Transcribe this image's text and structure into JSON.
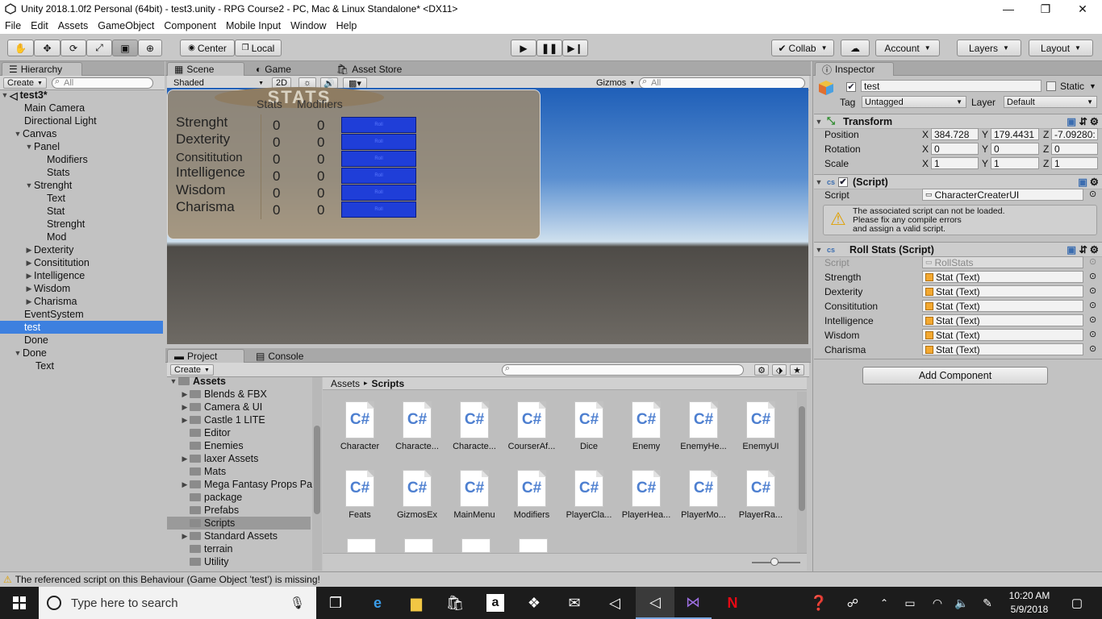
{
  "window": {
    "title": "Unity 2018.1.0f2 Personal (64bit) - test3.unity - RPG Course2 - PC, Mac & Linux Standalone* <DX11>",
    "minimize": "—",
    "maximize": "❐",
    "close": "✕"
  },
  "menu": [
    "File",
    "Edit",
    "Assets",
    "GameObject",
    "Component",
    "Mobile Input",
    "Window",
    "Help"
  ],
  "toolbar": {
    "pivot": "Center",
    "space": "Local",
    "collab": "Collab",
    "account": "Account",
    "layers": "Layers",
    "layout": "Layout"
  },
  "hierarchy": {
    "tab": "Hierarchy",
    "create": "Create",
    "search_placeholder": "All",
    "scene": "test3*",
    "items": [
      "Main Camera",
      "Directional Light",
      "Canvas",
      "Panel",
      "Modifiers",
      "Stats",
      "Strenght",
      "Text",
      "Stat",
      "Strenght",
      "Mod",
      "Dexterity",
      "Consititution",
      "Intelligence",
      "Wisdom",
      "Charisma",
      "EventSystem",
      "test",
      "Done",
      "Done",
      "Text"
    ]
  },
  "scene": {
    "tabs": [
      "Scene",
      "Game",
      "Asset Store"
    ],
    "shading": "Shaded",
    "mode2d": "2D",
    "gizmos": "Gizmos",
    "search_placeholder": "All",
    "panel": {
      "banner": "STATS",
      "col_stats": "Stats",
      "col_mods": "Modifiers",
      "rows": [
        {
          "name": "Strenght",
          "stat": "0",
          "mod": "0",
          "btn": "Roll"
        },
        {
          "name": "Dexterity",
          "stat": "0",
          "mod": "0",
          "btn": "Roll"
        },
        {
          "name": "Consititution",
          "stat": "0",
          "mod": "0",
          "btn": "Roll"
        },
        {
          "name": "Intelligence",
          "stat": "0",
          "mod": "0",
          "btn": "Roll"
        },
        {
          "name": "Wisdom",
          "stat": "0",
          "mod": "0",
          "btn": "Roll"
        },
        {
          "name": "Charisma",
          "stat": "0",
          "mod": "0",
          "btn": "Roll"
        }
      ]
    }
  },
  "project": {
    "tabs": [
      "Project",
      "Console"
    ],
    "create": "Create",
    "root": "Assets",
    "folders": [
      "Blends & FBX",
      "Camera & UI",
      "Castle 1 LITE",
      "Editor",
      "Enemies",
      "laxer Assets",
      "Mats",
      "Mega Fantasy Props Pa",
      "package",
      "Prefabs",
      "Scripts",
      "Standard Assets",
      "terrain",
      "Utility"
    ],
    "breadcrumb": [
      "Assets",
      "Scripts"
    ],
    "assets": [
      "Character",
      "Characte...",
      "Characte...",
      "CourserAf...",
      "Dice",
      "Enemy",
      "EnemyHe...",
      "EnemyUI",
      "Feats",
      "GizmosEx",
      "MainMenu",
      "Modifiers",
      "PlayerCla...",
      "PlayerHea...",
      "PlayerMo...",
      "PlayerRa..."
    ],
    "asset_icon": "C#"
  },
  "inspector": {
    "tab": "Inspector",
    "name": "test",
    "static": "Static",
    "tag_label": "Tag",
    "tag": "Untagged",
    "layer_label": "Layer",
    "layer": "Default",
    "transform": {
      "title": "Transform",
      "pos_label": "Position",
      "rot_label": "Rotation",
      "scale_label": "Scale",
      "px": "384.728",
      "py": "179.4431",
      "pz": "-7.09280:",
      "rx": "0",
      "ry": "0",
      "rz": "0",
      "sx": "1",
      "sy": "1",
      "sz": "1"
    },
    "missing": {
      "title": "(Script)",
      "script_label": "Script",
      "script": "CharacterCreaterUI",
      "warn1": "The associated script can not be loaded.",
      "warn2": "Please fix any compile errors",
      "warn3": "and assign a valid script."
    },
    "roll": {
      "title": "Roll Stats (Script)",
      "script_label": "Script",
      "script": "RollStats",
      "fields": [
        {
          "label": "Strength",
          "value": "Stat (Text)"
        },
        {
          "label": "Dexterity",
          "value": "Stat (Text)"
        },
        {
          "label": "Consititution",
          "value": "Stat (Text)"
        },
        {
          "label": "Intelligence",
          "value": "Stat (Text)"
        },
        {
          "label": "Wisdom",
          "value": "Stat (Text)"
        },
        {
          "label": "Charisma",
          "value": "Stat (Text)"
        }
      ]
    },
    "add_component": "Add Component"
  },
  "status": "The referenced script on this Behaviour (Game Object 'test') is missing!",
  "taskbar": {
    "search": "Type here to search",
    "time": "10:20 AM",
    "date": "5/9/2018"
  }
}
